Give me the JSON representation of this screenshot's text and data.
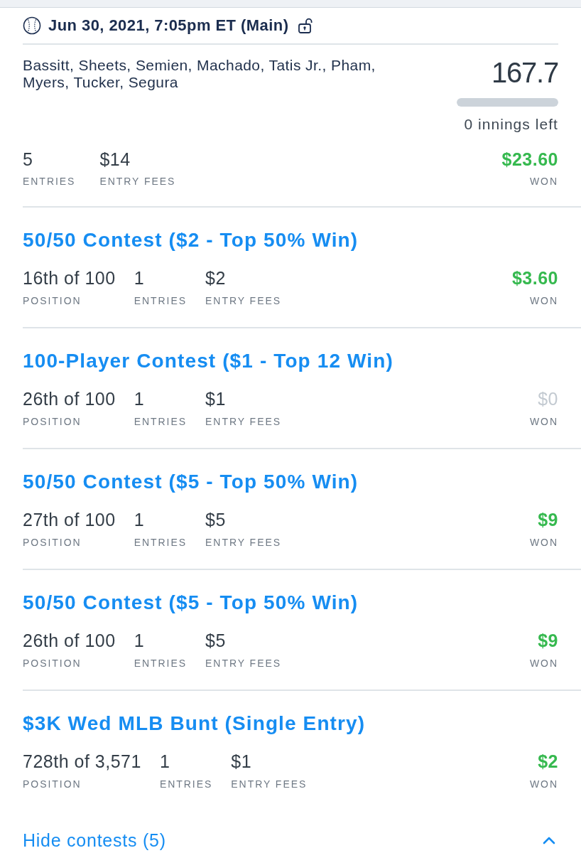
{
  "event": {
    "title": "Jun 30, 2021, 7:05pm ET (Main)"
  },
  "lineup": {
    "players": "Bassitt, Sheets, Semien, Machado, Tatis Jr., Pham, Myers, Tucker, Segura",
    "score": "167.7",
    "progress": {
      "level": 1
    },
    "remaining": "0 innings left"
  },
  "summary": {
    "stats": [
      {
        "value": "5",
        "label": "ENTRIES"
      },
      {
        "value": "$14",
        "label": "ENTRY FEES"
      }
    ],
    "won": {
      "value": "$23.60",
      "label": "WON",
      "winning": true
    }
  },
  "contests": [
    {
      "title": "50/50 Contest ($2 - Top 50% Win)",
      "stats": [
        {
          "value": "16th of 100",
          "label": "POSITION"
        },
        {
          "value": "1",
          "label": "ENTRIES"
        },
        {
          "value": "$2",
          "label": "ENTRY FEES"
        }
      ],
      "won": {
        "value": "$3.60",
        "label": "WON",
        "winning": true
      }
    },
    {
      "title": "100-Player Contest ($1 - Top 12 Win)",
      "stats": [
        {
          "value": "26th of 100",
          "label": "POSITION"
        },
        {
          "value": "1",
          "label": "ENTRIES"
        },
        {
          "value": "$1",
          "label": "ENTRY FEES"
        }
      ],
      "won": {
        "value": "$0",
        "label": "WON",
        "winning": false
      }
    },
    {
      "title": "50/50 Contest ($5 - Top 50% Win)",
      "stats": [
        {
          "value": "27th of 100",
          "label": "POSITION"
        },
        {
          "value": "1",
          "label": "ENTRIES"
        },
        {
          "value": "$5",
          "label": "ENTRY FEES"
        }
      ],
      "won": {
        "value": "$9",
        "label": "WON",
        "winning": true
      }
    },
    {
      "title": "50/50 Contest ($5 - Top 50% Win)",
      "stats": [
        {
          "value": "26th of 100",
          "label": "POSITION"
        },
        {
          "value": "1",
          "label": "ENTRIES"
        },
        {
          "value": "$5",
          "label": "ENTRY FEES"
        }
      ],
      "won": {
        "value": "$9",
        "label": "WON",
        "winning": true
      }
    },
    {
      "title": "$3K Wed MLB Bunt (Single Entry)",
      "stats": [
        {
          "value": "728th of 3,571",
          "label": "POSITION"
        },
        {
          "value": "1",
          "label": "ENTRIES"
        },
        {
          "value": "$1",
          "label": "ENTRY FEES"
        }
      ],
      "won": {
        "value": "$2",
        "label": "WON",
        "winning": true
      }
    }
  ],
  "toggle": {
    "label": "Hide contests (5)",
    "expanded": true
  }
}
